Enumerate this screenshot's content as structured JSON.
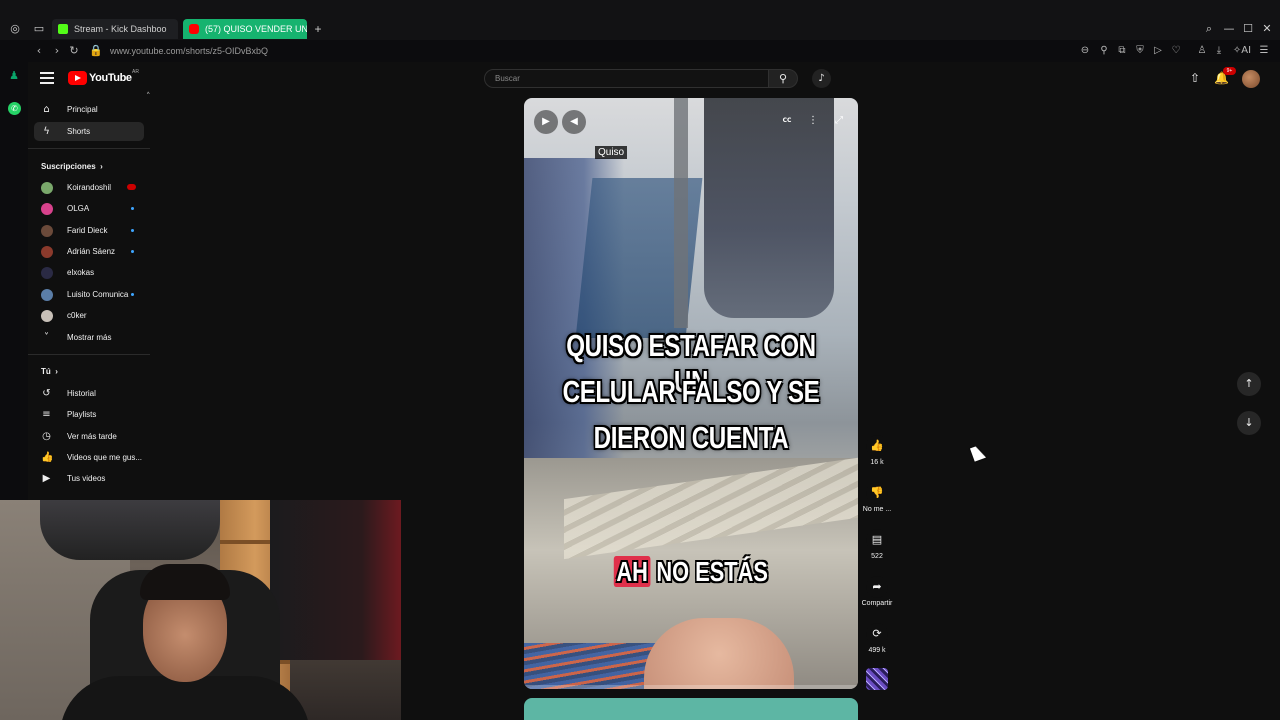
{
  "browser": {
    "tabs": [
      {
        "label": "Stream - Kick Dashboo",
        "icon": "kick-icon"
      },
      {
        "label": "(57) QUISO VENDER UN C",
        "icon": "youtube-icon"
      }
    ],
    "new_tab": "+",
    "url": "www.youtube.com/shorts/z5-OIDvBxbQ",
    "accent_color": "#16b36f"
  },
  "header": {
    "logo_text": "YouTube",
    "logo_region": "AR",
    "search_placeholder": "Buscar",
    "notification_count": "9+"
  },
  "sidebar": {
    "main": [
      {
        "label": "Principal",
        "icon": "home-icon"
      },
      {
        "label": "Shorts",
        "icon": "shorts-icon",
        "active": true
      }
    ],
    "subscriptions_title": "Suscripciones",
    "subscriptions": [
      {
        "label": "Koirandoshil",
        "live": true,
        "color": "#7aa86b"
      },
      {
        "label": "OLGA",
        "live": false,
        "color": "#d8428c"
      },
      {
        "label": "Farid Dieck",
        "live": false,
        "color": "#6b4a3a"
      },
      {
        "label": "Adrián Sáenz",
        "live": false,
        "color": "#8b3a2c"
      },
      {
        "label": "elxokas",
        "live": false,
        "color": "#2a2a44"
      },
      {
        "label": "Luisito Comunica",
        "live": false,
        "color": "#5b7ea8"
      },
      {
        "label": "c0ker",
        "live": false,
        "color": "#c8c0b8"
      }
    ],
    "show_more": "Mostrar más",
    "you_title": "Tú",
    "you_items": [
      {
        "label": "Historial",
        "icon": "history-icon"
      },
      {
        "label": "Playlists",
        "icon": "playlists-icon"
      },
      {
        "label": "Ver más tarde",
        "icon": "watch-later-icon"
      },
      {
        "label": "Videos que me gus...",
        "icon": "liked-icon"
      },
      {
        "label": "Tus videos",
        "icon": "your-videos-icon"
      }
    ]
  },
  "short": {
    "top_caption": "Quiso",
    "title_caption_lines": [
      "QUISO ESTAFAR CON UN",
      "CELULAR FALSO Y SE",
      "DIERON CUENTA"
    ],
    "bottom_caption_highlight": "AH",
    "bottom_caption_rest": "NO ESTÁS",
    "cc_label": "CC",
    "progress": 0.0
  },
  "actions": {
    "likes": "16 k",
    "dislike_label": "No me ...",
    "comments": "522",
    "share_label": "Compartir",
    "remix_count": "499 k"
  }
}
